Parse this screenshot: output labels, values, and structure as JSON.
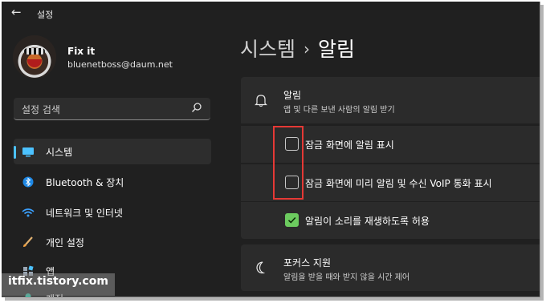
{
  "window": {
    "title": "설정"
  },
  "profile": {
    "name": "Fix it",
    "email": "bluenetboss@daum.net"
  },
  "search": {
    "placeholder": "설정 검색"
  },
  "sidebar": {
    "items": [
      {
        "label": "시스템",
        "icon": "monitor-icon",
        "selected": true
      },
      {
        "label": "Bluetooth & 장치",
        "icon": "bluetooth-icon",
        "selected": false
      },
      {
        "label": "네트워크 및 인터넷",
        "icon": "wifi-icon",
        "selected": false
      },
      {
        "label": "개인 설정",
        "icon": "brush-icon",
        "selected": false
      },
      {
        "label": "앱",
        "icon": "apps-icon",
        "selected": false
      },
      {
        "label": "계정",
        "icon": "account-icon",
        "selected": false
      }
    ]
  },
  "breadcrumb": {
    "parent": "시스템",
    "separator": "›",
    "current": "알림"
  },
  "notifications": {
    "title": "알림",
    "subtitle": "앱 및 다른 보낸 사람의 알림 받기",
    "icon": "bell-icon",
    "options": [
      {
        "label": "잠금 화면에 알림 표시",
        "checked": false
      },
      {
        "label": "잠금 화면에 미리 알림 및 수신 VoIP 통화 표시",
        "checked": false
      },
      {
        "label": "알림이 소리를 재생하도록 허용",
        "checked": true
      }
    ]
  },
  "focus_assist": {
    "title": "포커스 지원",
    "subtitle": "알림을 받을 때와 받지 않을 시간 제어",
    "icon": "moon-icon"
  },
  "watermark": "itfix.tistory.com",
  "colors": {
    "accent": "#4cc2ff",
    "checked": "#6ccb5f",
    "highlight": "#e53935",
    "background": "#202020",
    "card": "#2b2b2b"
  }
}
